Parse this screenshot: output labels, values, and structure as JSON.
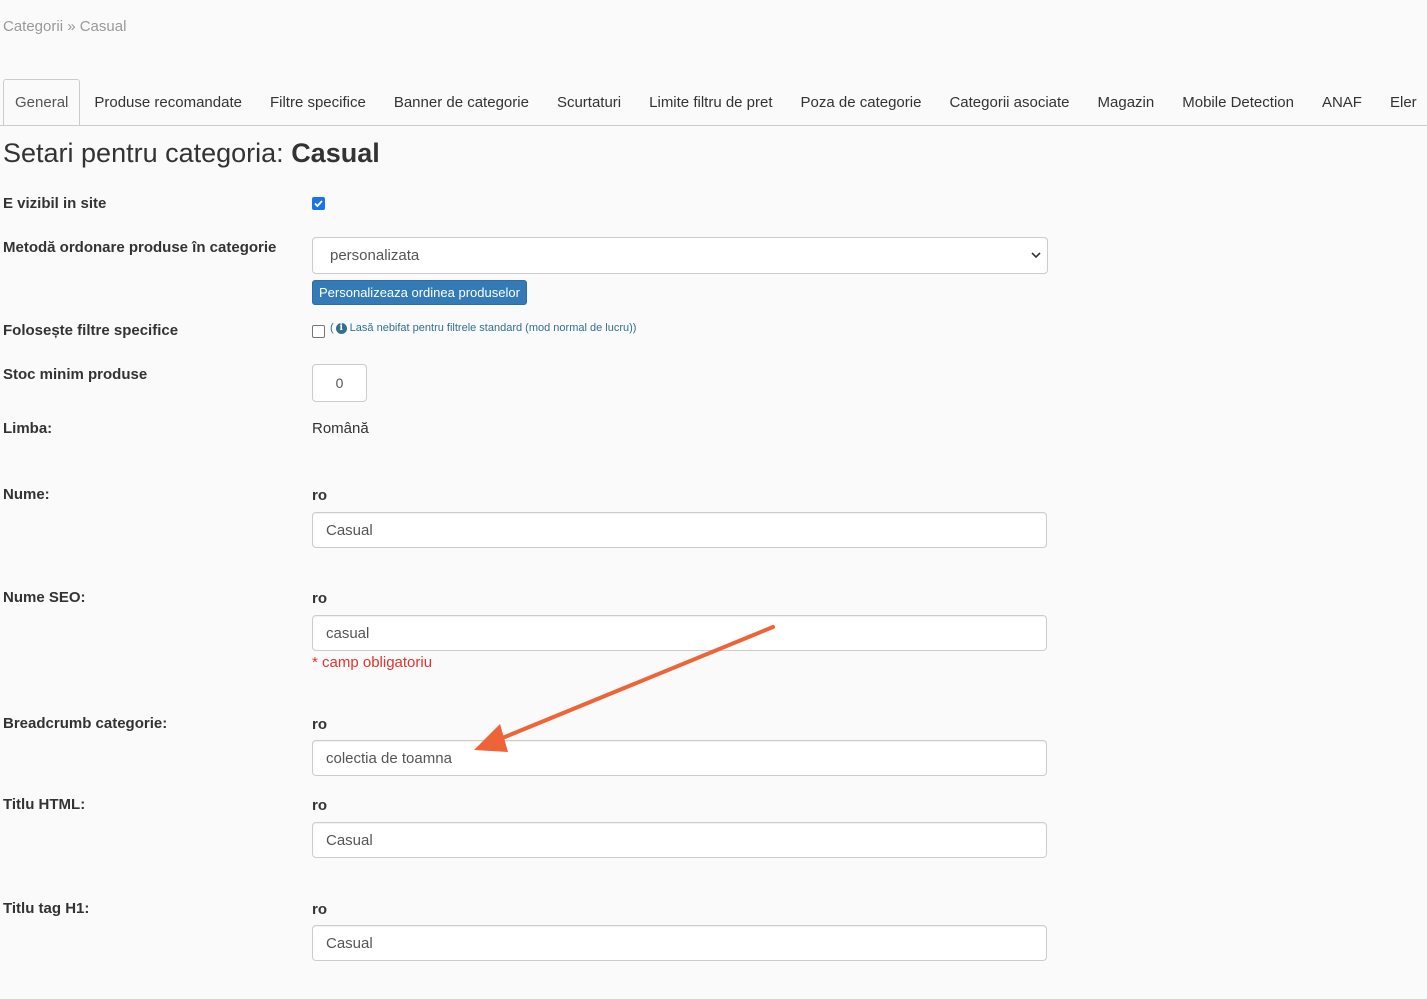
{
  "breadcrumb": {
    "root": "Categorii",
    "separator": "»",
    "current": "Casual"
  },
  "tabs": [
    {
      "label": "General",
      "active": true
    },
    {
      "label": "Produse recomandate"
    },
    {
      "label": "Filtre specifice"
    },
    {
      "label": "Banner de categorie"
    },
    {
      "label": "Scurtaturi"
    },
    {
      "label": "Limite filtru de pret"
    },
    {
      "label": "Poza de categorie"
    },
    {
      "label": "Categorii asociate"
    },
    {
      "label": "Magazin"
    },
    {
      "label": "Mobile Detection"
    },
    {
      "label": "ANAF"
    },
    {
      "label": "Eler"
    }
  ],
  "heading": {
    "prefix": "Setari pentru categoria:",
    "category": "Casual"
  },
  "fields": {
    "visible": {
      "label": "E vizibil in site",
      "checked": true
    },
    "sort_method": {
      "label": "Metodă ordonare produse în categorie",
      "value": "personalizata",
      "button": "Personalizeaza ordinea produselor"
    },
    "specific_filters": {
      "label": "Folosește filtre specifice",
      "checked": false,
      "hint_open": "(",
      "hint": "Lasă nebifat pentru filtrele standard (mod normal de lucru))"
    },
    "min_stock": {
      "label": "Stoc minim produse",
      "value": "0"
    },
    "language": {
      "label": "Limba:",
      "value": "Română"
    },
    "name": {
      "label": "Nume:",
      "lang": "ro",
      "value": "Casual"
    },
    "seo_name": {
      "label": "Nume SEO:",
      "lang": "ro",
      "value": "casual",
      "required": "* camp obligatoriu"
    },
    "breadcrumb_cat": {
      "label": "Breadcrumb categorie:",
      "lang": "ro",
      "value": "colectia de toamna"
    },
    "html_title": {
      "label": "Titlu HTML:",
      "lang": "ro",
      "value": "Casual"
    },
    "h1_title": {
      "label": "Titlu tag H1:",
      "lang": "ro",
      "value": "Casual"
    }
  },
  "colors": {
    "accent": "#337ab7",
    "checkbox": "#1a73e8",
    "required": "#e3342f",
    "hint": "#31708f",
    "annotation_arrow": "#ec6437"
  },
  "icons": [
    "chevron-down-icon",
    "info-icon",
    "checkmark-icon",
    "annotation-arrow"
  ]
}
